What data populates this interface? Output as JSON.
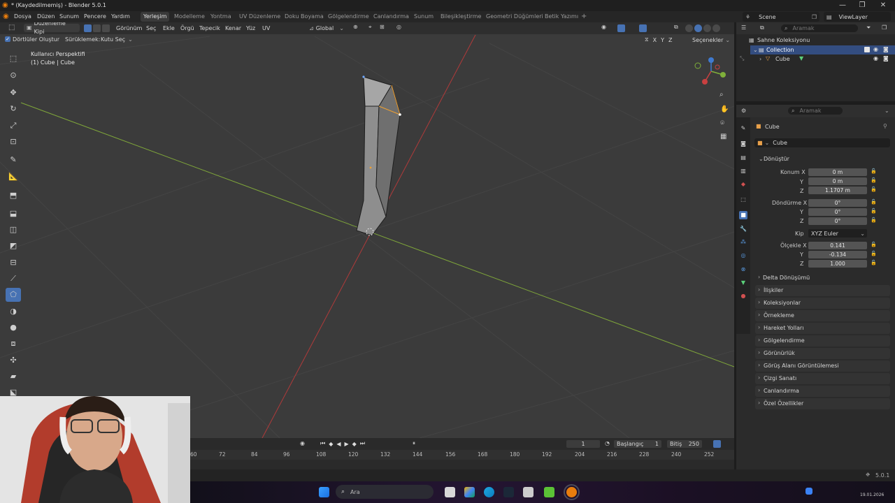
{
  "window": {
    "title": "* (Kaydedilmemiş) - Blender 5.0.1",
    "controls": [
      "—",
      "❐",
      "✕"
    ]
  },
  "menubar": {
    "menus": [
      "Dosya",
      "Düzen",
      "Sunum",
      "Pencere",
      "Yardım"
    ],
    "workspaces": [
      "Yerleşim",
      "Modelleme",
      "Yontma",
      "UV Düzenleme",
      "Doku Boyama",
      "Gölgelendirme",
      "Canlandırma",
      "Sunum",
      "Bileşikleştirme",
      "Geometri Düğümleri",
      "Betik Yazımı"
    ],
    "active_workspace": "Yerleşim",
    "add_tab": "+",
    "scene": "Scene",
    "view_layer": "ViewLayer"
  },
  "viewport_header": {
    "mode": "Düzenleme Kipi",
    "menus": [
      "Görünüm",
      "Seç",
      "Ekle",
      "Örgü",
      "Tepecik",
      "Kenar",
      "Yüz",
      "UV"
    ],
    "transform_orientation": "Global",
    "options": "Seçenekler",
    "axes": [
      "X",
      "Y",
      "Z"
    ]
  },
  "tool_header": {
    "checkbox_label": "Dörtlüler Oluştur",
    "drag_label": "Sürüklemek:",
    "drag_value": "Kutu Seç"
  },
  "viewport": {
    "view_name": "Kullanıcı Perspektifi",
    "object_info": "(1) Cube | Cube"
  },
  "outliner": {
    "search_placeholder": "Aramak",
    "scene_collection": "Sahne Koleksiyonu",
    "collection": "Collection",
    "object": "Cube"
  },
  "properties": {
    "search_placeholder": "Aramak",
    "object_name": "Cube",
    "object_field": "Cube",
    "transform_header": "Dönüştür",
    "location": {
      "label": "Konum X",
      "x": "0 m",
      "y": "0 m",
      "z": "1.1707 m"
    },
    "rotation": {
      "label": "Döndürme X",
      "x": "0°",
      "y": "0°",
      "z": "0°"
    },
    "mode": {
      "label": "Kip",
      "value": "XYZ Euler"
    },
    "scale": {
      "label": "Ölçekle X",
      "x": "0.141",
      "y": "-0.134",
      "z": "1.000"
    },
    "axis_y": "Y",
    "axis_z": "Z",
    "delta": "Delta Dönüşümü",
    "panels": [
      "İlişkiler",
      "Koleksiyonlar",
      "Örnekleme",
      "Hareket Yolları",
      "Gölgelendirme",
      "Görünürlük",
      "Görüş Alanı Görüntülemesi",
      "Çizgi Sanatı",
      "Canlandırma",
      "Özel Özellikler"
    ]
  },
  "timeline": {
    "current_frame": "1",
    "start_label": "Başlangıç",
    "start": "1",
    "end_label": "Bitiş",
    "end": "250",
    "ticks": [
      "60",
      "72",
      "84",
      "96",
      "108",
      "120",
      "132",
      "144",
      "156",
      "168",
      "180",
      "192",
      "204",
      "216",
      "228",
      "240",
      "252"
    ]
  },
  "statusbar": {
    "version": "5.0.1"
  },
  "taskbar": {
    "search_placeholder": "Ara",
    "clock_date": "19.01.2026"
  },
  "colors": {
    "accent": "#4772b3",
    "viewport_bg": "#3b3b3b",
    "x_axis": "#c0392b",
    "y_axis": "#8ab832",
    "collection_icon": "#d6d6d6"
  }
}
